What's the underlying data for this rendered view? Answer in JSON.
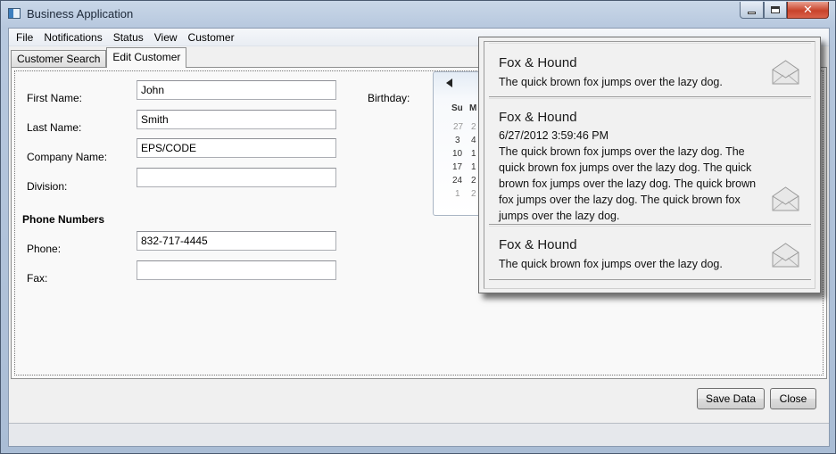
{
  "window": {
    "title": "Business Application"
  },
  "menu": [
    "File",
    "Notifications",
    "Status",
    "View",
    "Customer"
  ],
  "tabs": [
    {
      "label": "Customer Search",
      "active": false
    },
    {
      "label": "Edit Customer",
      "active": true
    }
  ],
  "form": {
    "first_name": {
      "label": "First Name:",
      "value": "John"
    },
    "last_name": {
      "label": "Last Name:",
      "value": "Smith"
    },
    "company_name": {
      "label": "Company Name:",
      "value": "EPS/CODE"
    },
    "division": {
      "label": "Division:",
      "value": ""
    },
    "phone_section": "Phone Numbers",
    "phone": {
      "label": "Phone:",
      "value": "832-717-4445"
    },
    "fax": {
      "label": "Fax:",
      "value": ""
    },
    "birthday": {
      "label": "Birthday:"
    }
  },
  "calendar": {
    "dow": [
      "Su",
      "M"
    ],
    "rows": [
      [
        "27",
        "2"
      ],
      [
        "3",
        "4"
      ],
      [
        "10",
        "1"
      ],
      [
        "17",
        "1"
      ],
      [
        "24",
        "2"
      ],
      [
        "1",
        "2"
      ]
    ]
  },
  "buttons": {
    "save": "Save Data",
    "close": "Close"
  },
  "notifications": [
    {
      "title": "Fox & Hound",
      "time": "",
      "body": "The quick brown fox jumps over the lazy dog."
    },
    {
      "title": "Fox & Hound",
      "time": "6/27/2012 3:59:46 PM",
      "body": "The quick brown fox jumps over the lazy dog. The quick brown fox jumps over the lazy dog. The quick brown fox jumps over the lazy dog. The quick brown fox jumps over the lazy dog. The quick brown fox jumps over the lazy dog."
    },
    {
      "title": "Fox & Hound",
      "time": "",
      "body": "The quick brown fox jumps over the lazy dog."
    }
  ],
  "icons": {
    "notification": "envelope-icon",
    "app": "app-window-icon"
  }
}
